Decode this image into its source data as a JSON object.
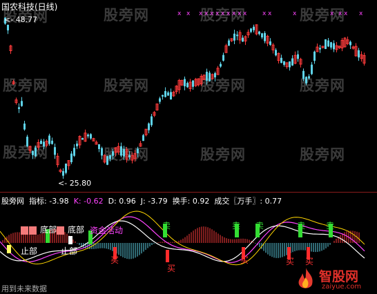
{
  "title": "国农科技(日线)",
  "price_high_label": "48.77",
  "price_low_label": "25.80",
  "indicator_bar": {
    "name": "股旁网",
    "items": [
      {
        "label": "指标:",
        "value": "-3.98",
        "color": "#ffffff"
      },
      {
        "label": "K:",
        "value": "-0.62",
        "color": "#ff44ff"
      },
      {
        "label": "D:",
        "value": "0.96",
        "color": "#ffffff"
      },
      {
        "label": "J:",
        "value": "-3.79",
        "color": "#ffffff"
      },
      {
        "label": "换手:",
        "value": "0.92",
        "color": "#ffffff"
      },
      {
        "label": "成交〖万手〗:",
        "value": "0.77",
        "color": "#ffffff"
      }
    ]
  },
  "signals": {
    "bottom": "底部",
    "dibu_left": "底部",
    "zhongbu1": "止部",
    "zhongbu2": "止部",
    "capital": "资金活动",
    "sell": "卖",
    "buy": "买",
    "bottom_text": "用到未来数据"
  },
  "watermarks": [
    "股旁网",
    "股旁网",
    "股旁网",
    "股旁网",
    "股旁网",
    "股旁网",
    "股旁网",
    "股旁网",
    "股旁网",
    "股旁网",
    "股旁网",
    "股旁网"
  ],
  "logo": {
    "name": "智股网",
    "url": "zaiyue.com"
  },
  "colors": {
    "up": "#ff3b3b",
    "down": "#5fd3e8",
    "k": "#ff44ff",
    "d": "#ffffff",
    "j": "#ffd600"
  }
}
